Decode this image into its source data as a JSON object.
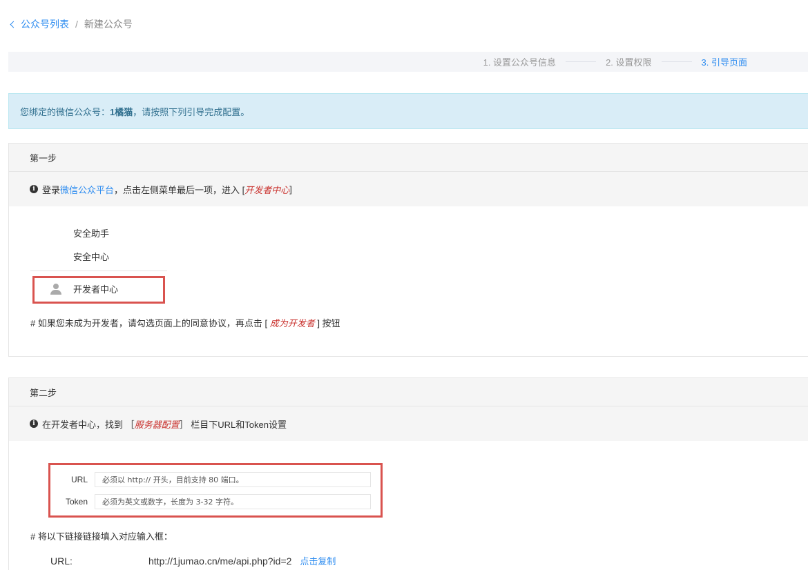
{
  "breadcrumb": {
    "back_label": "公众号列表",
    "separator": "/",
    "current": "新建公众号"
  },
  "steps": [
    {
      "label": "1. 设置公众号信息",
      "active": false
    },
    {
      "label": "2. 设置权限",
      "active": false
    },
    {
      "label": "3. 引导页面",
      "active": true
    }
  ],
  "alert": {
    "prefix": "您绑定的微信公众号：",
    "account": "1橘猫",
    "suffix": "，请按照下列引导完成配置。"
  },
  "step1": {
    "title": "第一步",
    "tip_prefix": "登录 ",
    "tip_link": "微信公众平台",
    "tip_mid": "，点击左侧菜单最后一项，进入 [ ",
    "tip_em": "开发者中心",
    "tip_suffix": " ]",
    "menu": [
      "安全助手",
      "安全中心"
    ],
    "dev_center": "开发者中心",
    "note_prefix": "# 如果您未成为开发者，请勾选页面上的同意协议，再点击 [ ",
    "note_em": "成为开发者",
    "note_suffix": " ] 按钮"
  },
  "step2": {
    "title": "第二步",
    "tip_prefix": "在开发者中心，找到 ［ ",
    "tip_em": "服务器配置",
    "tip_suffix": " ］ 栏目下URL和Token设置",
    "url_label": "URL",
    "url_placeholder": "必须以 http:// 开头，目前支持 80 端口。",
    "token_label": "Token",
    "token_placeholder": "必须为英文或数字，长度为 3-32 字符。",
    "note": "# 将以下链接链接填入对应输入框：",
    "copy_key": "URL:",
    "copy_value": "http://1jumao.cn/me/api.php?id=2",
    "copy_action": "点击复制"
  },
  "colors": {
    "accent": "#2d8cf0",
    "highlight": "#d9534f",
    "alert_bg": "#d9edf7",
    "alert_text": "#31708f"
  }
}
